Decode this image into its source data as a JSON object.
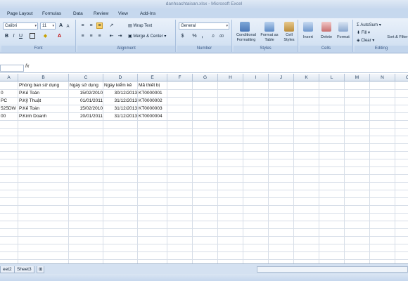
{
  "window": {
    "title": "danhsachtaisan.xlsx - Microsoft Excel"
  },
  "ribbon_tabs": [
    "Page Layout",
    "Formulas",
    "Data",
    "Review",
    "View",
    "Add-Ins"
  ],
  "ribbon": {
    "font": {
      "name": "Calibri",
      "size": "11",
      "group_label": "Font"
    },
    "alignment": {
      "wrap_text": "Wrap Text",
      "merge_center": "Merge & Center",
      "group_label": "Alignment"
    },
    "number": {
      "format": "General",
      "percent": "%",
      "comma": ",",
      "group_label": "Number"
    },
    "styles": {
      "conditional": "Conditional Formatting",
      "format_table": "Format as Table",
      "cell_styles": "Cell Styles",
      "group_label": "Styles"
    },
    "cells": {
      "insert": "Insert",
      "delete": "Delete",
      "format": "Format",
      "group_label": "Cells"
    },
    "editing": {
      "autosum": "AutoSum",
      "fill": "Fill",
      "clear": "Clear",
      "sort_filter": "Sort & Filter",
      "group_label": "Editing"
    }
  },
  "formula_bar": {
    "fx": "fx",
    "value": ""
  },
  "columns": [
    "A",
    "B",
    "C",
    "D",
    "E",
    "F",
    "G",
    "H",
    "I",
    "J",
    "K",
    "L",
    "M",
    "N",
    "O"
  ],
  "rows": [
    {
      "a": "",
      "b": "Phòng ban sử dụng",
      "c": "Ngày sử dụng",
      "d": "Ngày kiểm kê",
      "e": "Mã thiết bị"
    },
    {
      "a": "0",
      "b": "P.Kế Toán",
      "c": "15/02/2010",
      "d": "30/12/2013",
      "e": "KT0000001"
    },
    {
      "a": "PC",
      "b": "P.Kỹ Thuật",
      "c": "01/01/2011",
      "d": "31/12/2013",
      "e": "KT0000002"
    },
    {
      "a": "525DW",
      "b": "P.Kế Toán",
      "c": "15/02/2010",
      "d": "31/12/2013",
      "e": "KT0000003"
    },
    {
      "a": "00",
      "b": "P.Kinh Doanh",
      "c": "20/01/2011",
      "d": "31/12/2013",
      "e": "KT0000004"
    }
  ],
  "sheet_tabs": [
    "eet2",
    "Sheet3"
  ],
  "colors": {
    "ribbon": "#d5e3f3",
    "accent": "#3b5a86"
  }
}
